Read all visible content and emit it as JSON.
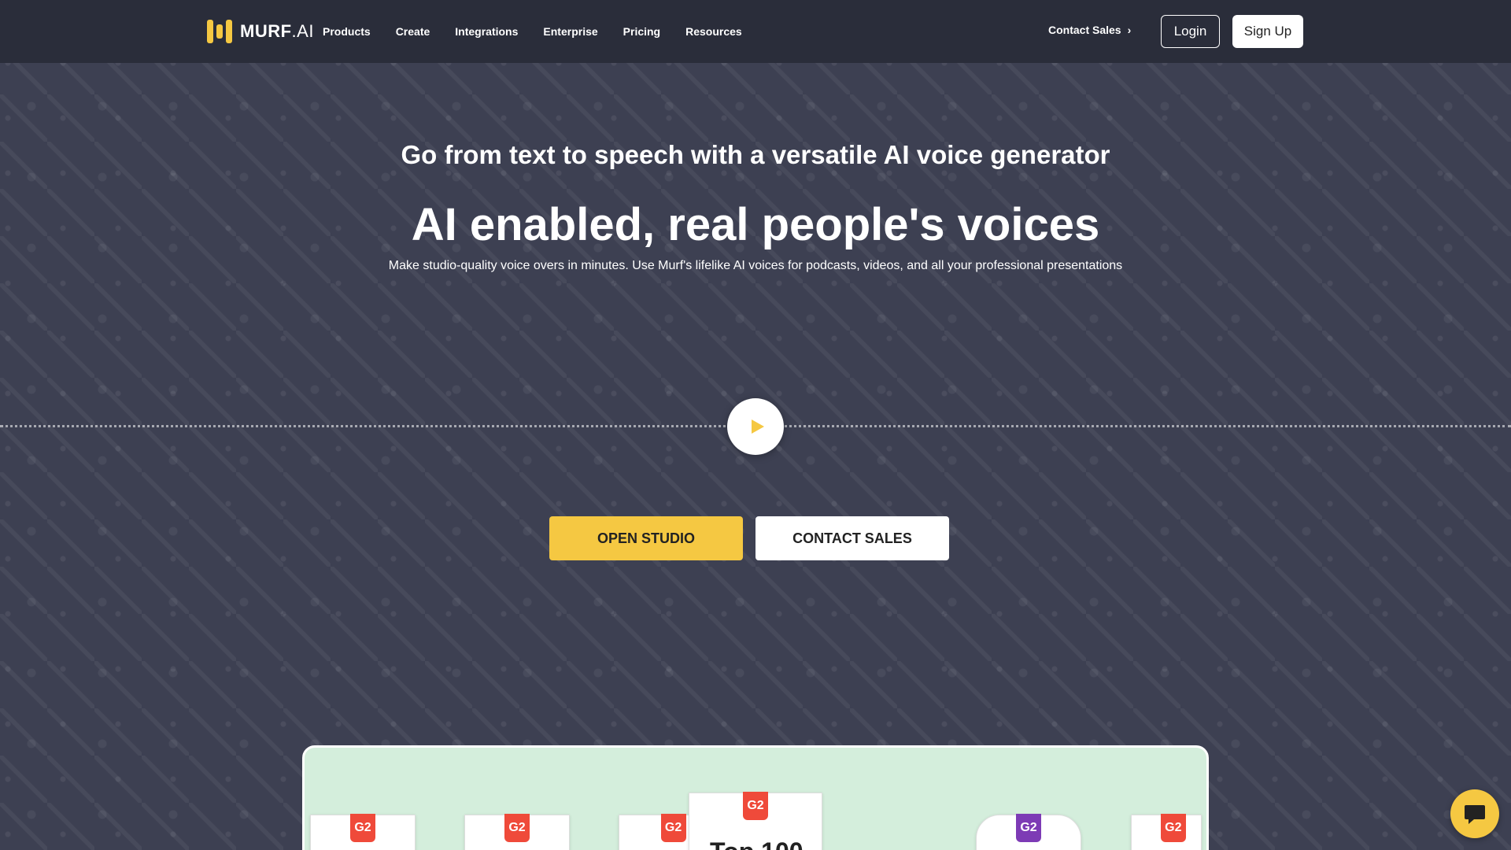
{
  "brand": {
    "name": "MURF",
    "suffix": ".AI"
  },
  "nav": {
    "items": [
      {
        "label": "Products"
      },
      {
        "label": "Create"
      },
      {
        "label": "Integrations"
      },
      {
        "label": "Enterprise"
      },
      {
        "label": "Pricing"
      },
      {
        "label": "Resources"
      }
    ],
    "contact_sales": "Contact Sales",
    "login": "Login",
    "signup": "Sign Up"
  },
  "hero": {
    "subtitle": "Go from text to speech with a versatile AI voice generator",
    "title": "AI enabled, real people's voices",
    "description": "Make studio-quality voice overs in minutes. Use Murf's lifelike AI voices for podcasts, videos, and all your professional presentations",
    "open_studio": "OPEN STUDIO",
    "contact_sales": "CONTACT SALES"
  },
  "badges": [
    {
      "logo": "G2",
      "text": ""
    },
    {
      "logo": "G2",
      "text": ""
    },
    {
      "logo": "G2",
      "text": ""
    },
    {
      "logo": "G2",
      "text": "Top 100"
    },
    {
      "logo": "G2",
      "text": ""
    },
    {
      "logo": "G2",
      "text": ""
    }
  ],
  "colors": {
    "accent": "#f5c842",
    "background": "#3d4052",
    "navbar": "#2a2d3a",
    "badge_panel": "#d4eedc",
    "g2_red": "#ef4a3a",
    "g2_purple": "#7d3bb5"
  },
  "icons": {
    "play": "play-icon",
    "chevron": "chevron-right-icon",
    "chat": "chat-icon"
  }
}
